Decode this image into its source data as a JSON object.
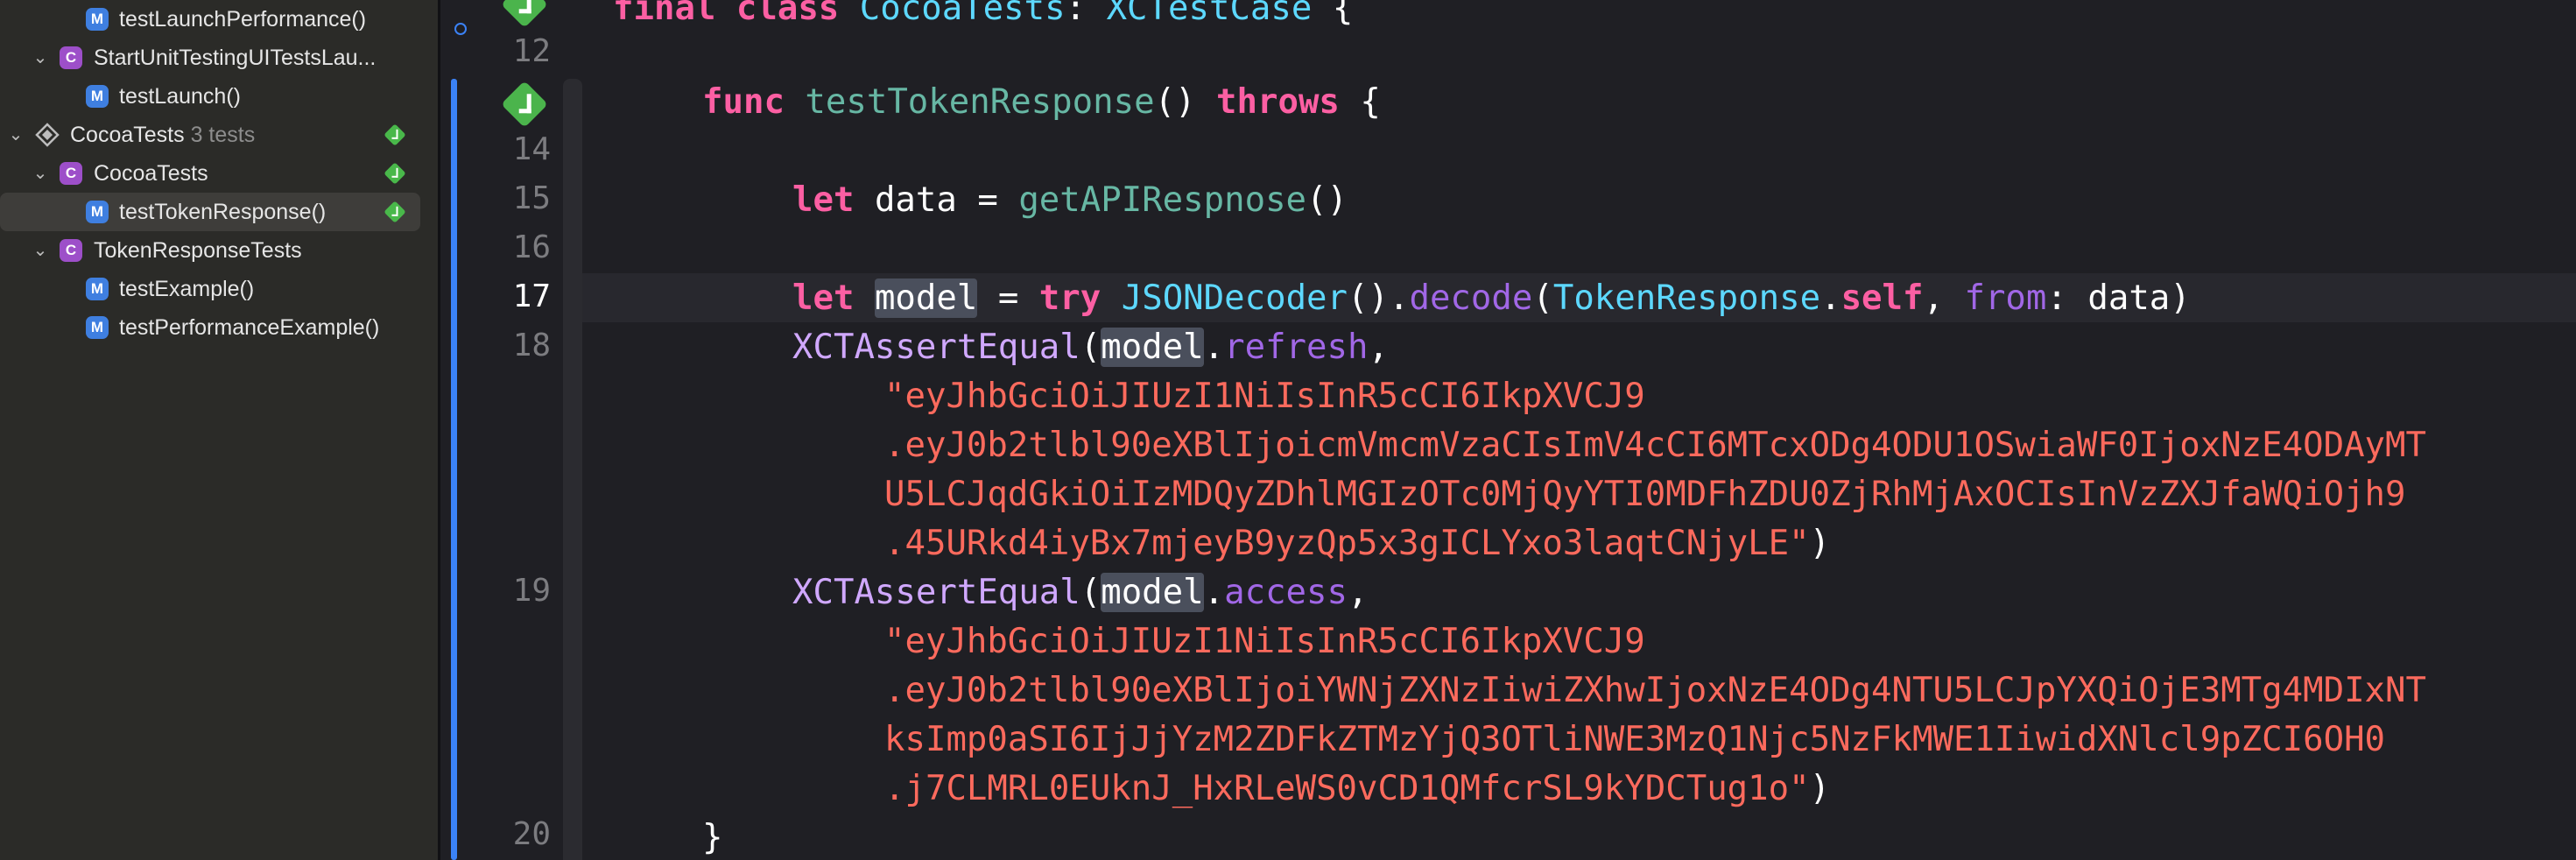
{
  "navigator": {
    "rows": [
      {
        "label": "testLaunchPerformance()",
        "badge": "M"
      },
      {
        "label": "StartUnitTestingUITestsLau...",
        "badge": "C"
      },
      {
        "label": "testLaunch()",
        "badge": "M"
      },
      {
        "label": "CocoaTests",
        "count": "3 tests"
      },
      {
        "label": "CocoaTests",
        "badge": "C"
      },
      {
        "label": "testTokenResponse()",
        "badge": "M"
      },
      {
        "label": "TokenResponseTests",
        "badge": "C"
      },
      {
        "label": "testExample()",
        "badge": "M"
      },
      {
        "label": "testPerformanceExample()",
        "badge": "M"
      }
    ]
  },
  "editor": {
    "line_numbers": [
      "12",
      "14",
      "15",
      "16",
      "17",
      "18",
      "19",
      "20"
    ],
    "current_line": "17",
    "code": {
      "l11_final": "final",
      "l11_class": "class",
      "l11_name": "CocoaTests",
      "l11_colon": ":",
      "l11_super": "XCTestCase",
      "l11_brace": "{",
      "l13_func": "func",
      "l13_name": "testTokenResponse",
      "l13_parens": "()",
      "l13_throws": "throws",
      "l13_brace": "{",
      "l15_let": "let",
      "l15_var": "data",
      "l15_eq": "=",
      "l15_call": "getAPIRespnose",
      "l15_parens": "()",
      "l17_let": "let",
      "l17_var": "model",
      "l17_eq": "=",
      "l17_try": "try",
      "l17_decoder": "JSONDecoder",
      "l17_parens": "().",
      "l17_decode": "decode",
      "l17_open": "(",
      "l17_type": "TokenResponse",
      "l17_dot": ".",
      "l17_self": "self",
      "l17_comma": ",",
      "l17_from": "from",
      "l17_colon": ":",
      "l17_data": "data)",
      "l18_assert": "XCTAssertEqual",
      "l18_open": "(",
      "l18_model": "model",
      "l18_dot": ".",
      "l18_prop": "refresh",
      "l18_comma": ",",
      "l18_s1": "\"eyJhbGciOiJIUzI1NiIsInR5cCI6IkpXVCJ9",
      "l18_s2": ".eyJ0b2tlbl90eXBlIjoicmVmcmVzaCIsImV4cCI6MTcxODg4ODU1OSwiaWF0IjoxNzE4ODAyMT",
      "l18_s3": "U5LCJqdGkiOiIzMDQyZDhlMGIzOTc0MjQyYTI0MDFhZDU0ZjRhMjAxOCIsInVzZXJfaWQiOjh9",
      "l18_s4": ".45URkd4iyBx7mjeyB9yzQp5x3gICLYxo3laqtCNjyLE\"",
      "l18_close": ")",
      "l19_assert": "XCTAssertEqual",
      "l19_open": "(",
      "l19_model": "model",
      "l19_dot": ".",
      "l19_prop": "access",
      "l19_comma": ",",
      "l19_s1": "\"eyJhbGciOiJIUzI1NiIsInR5cCI6IkpXVCJ9",
      "l19_s2": ".eyJ0b2tlbl90eXBlIjoiYWNjZXNzIiwiZXhwIjoxNzE4ODg4NTU5LCJpYXQiOjE3MTg4MDIxNT",
      "l19_s3": "ksImp0aSI6IjJjYzM2ZDFkZTMzYjQ3OTliNWE3MzQ1Njc5NzFkMWE1IiwidXNlcl9pZCI6OH0",
      "l19_s4": ".j7CLMRL0EUknJ_HxRLeWS0vCD1QMfcrSL9kYDCTug1o\"",
      "l19_close": ")",
      "l20_brace": "}"
    }
  },
  "colors": {
    "navigator_bg": "#2b2b28",
    "editor_bg": "#1f1f24",
    "keyword": "#fc5fa3",
    "string": "#fc6a5d",
    "type": "#5dd8ff",
    "function": "#67b7a4",
    "property": "#a167e6",
    "test_pass": "#4bb44c",
    "accent": "#3b82f6"
  }
}
